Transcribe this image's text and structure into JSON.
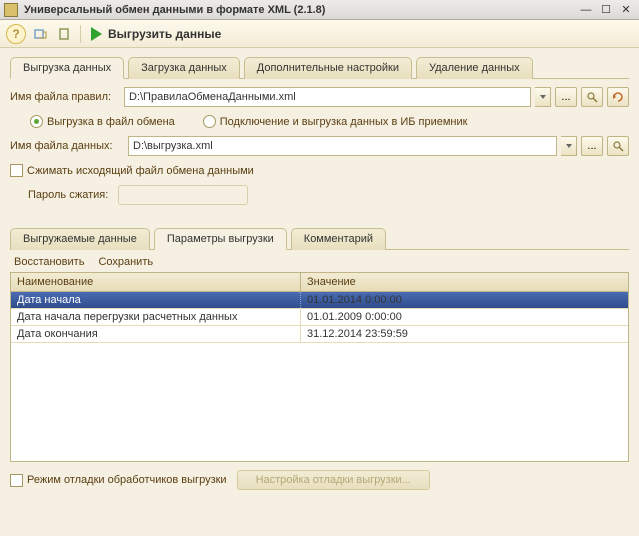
{
  "window": {
    "title": "Универсальный обмен данными в формате XML (2.1.8)"
  },
  "toolbar": {
    "export_label": "Выгрузить данные"
  },
  "main_tabs": [
    {
      "label": "Выгрузка данных"
    },
    {
      "label": "Загрузка данных"
    },
    {
      "label": "Дополнительные настройки"
    },
    {
      "label": "Удаление данных"
    }
  ],
  "rules_file": {
    "label": "Имя файла правил:",
    "value": "D:\\ПравилаОбменаДанными.xml"
  },
  "export_mode": {
    "to_file_label": "Выгрузка в файл обмена",
    "to_ib_label": "Подключение и выгрузка данных в ИБ приемник"
  },
  "data_file": {
    "label": "Имя файла данных:",
    "value": "D:\\выгрузка.xml"
  },
  "compress": {
    "label": "Сжимать исходящий файл обмена данными",
    "password_label": "Пароль сжатия:"
  },
  "sub_tabs": [
    {
      "label": "Выгружаемые данные"
    },
    {
      "label": "Параметры выгрузки"
    },
    {
      "label": "Комментарий"
    }
  ],
  "actions": {
    "restore": "Восстановить",
    "save": "Сохранить"
  },
  "grid": {
    "headers": {
      "name": "Наименование",
      "value": "Значение"
    },
    "rows": [
      {
        "name": "Дата начала",
        "value": "01.01.2014 0:00:00"
      },
      {
        "name": "Дата начала перегрузки расчетных данных",
        "value": "01.01.2009 0:00:00"
      },
      {
        "name": "Дата окончания",
        "value": "31.12.2014 23:59:59"
      }
    ]
  },
  "bottom": {
    "debug_label": "Режим отладки обработчиков выгрузки",
    "debug_settings_btn": "Настройка отладки выгрузки..."
  }
}
